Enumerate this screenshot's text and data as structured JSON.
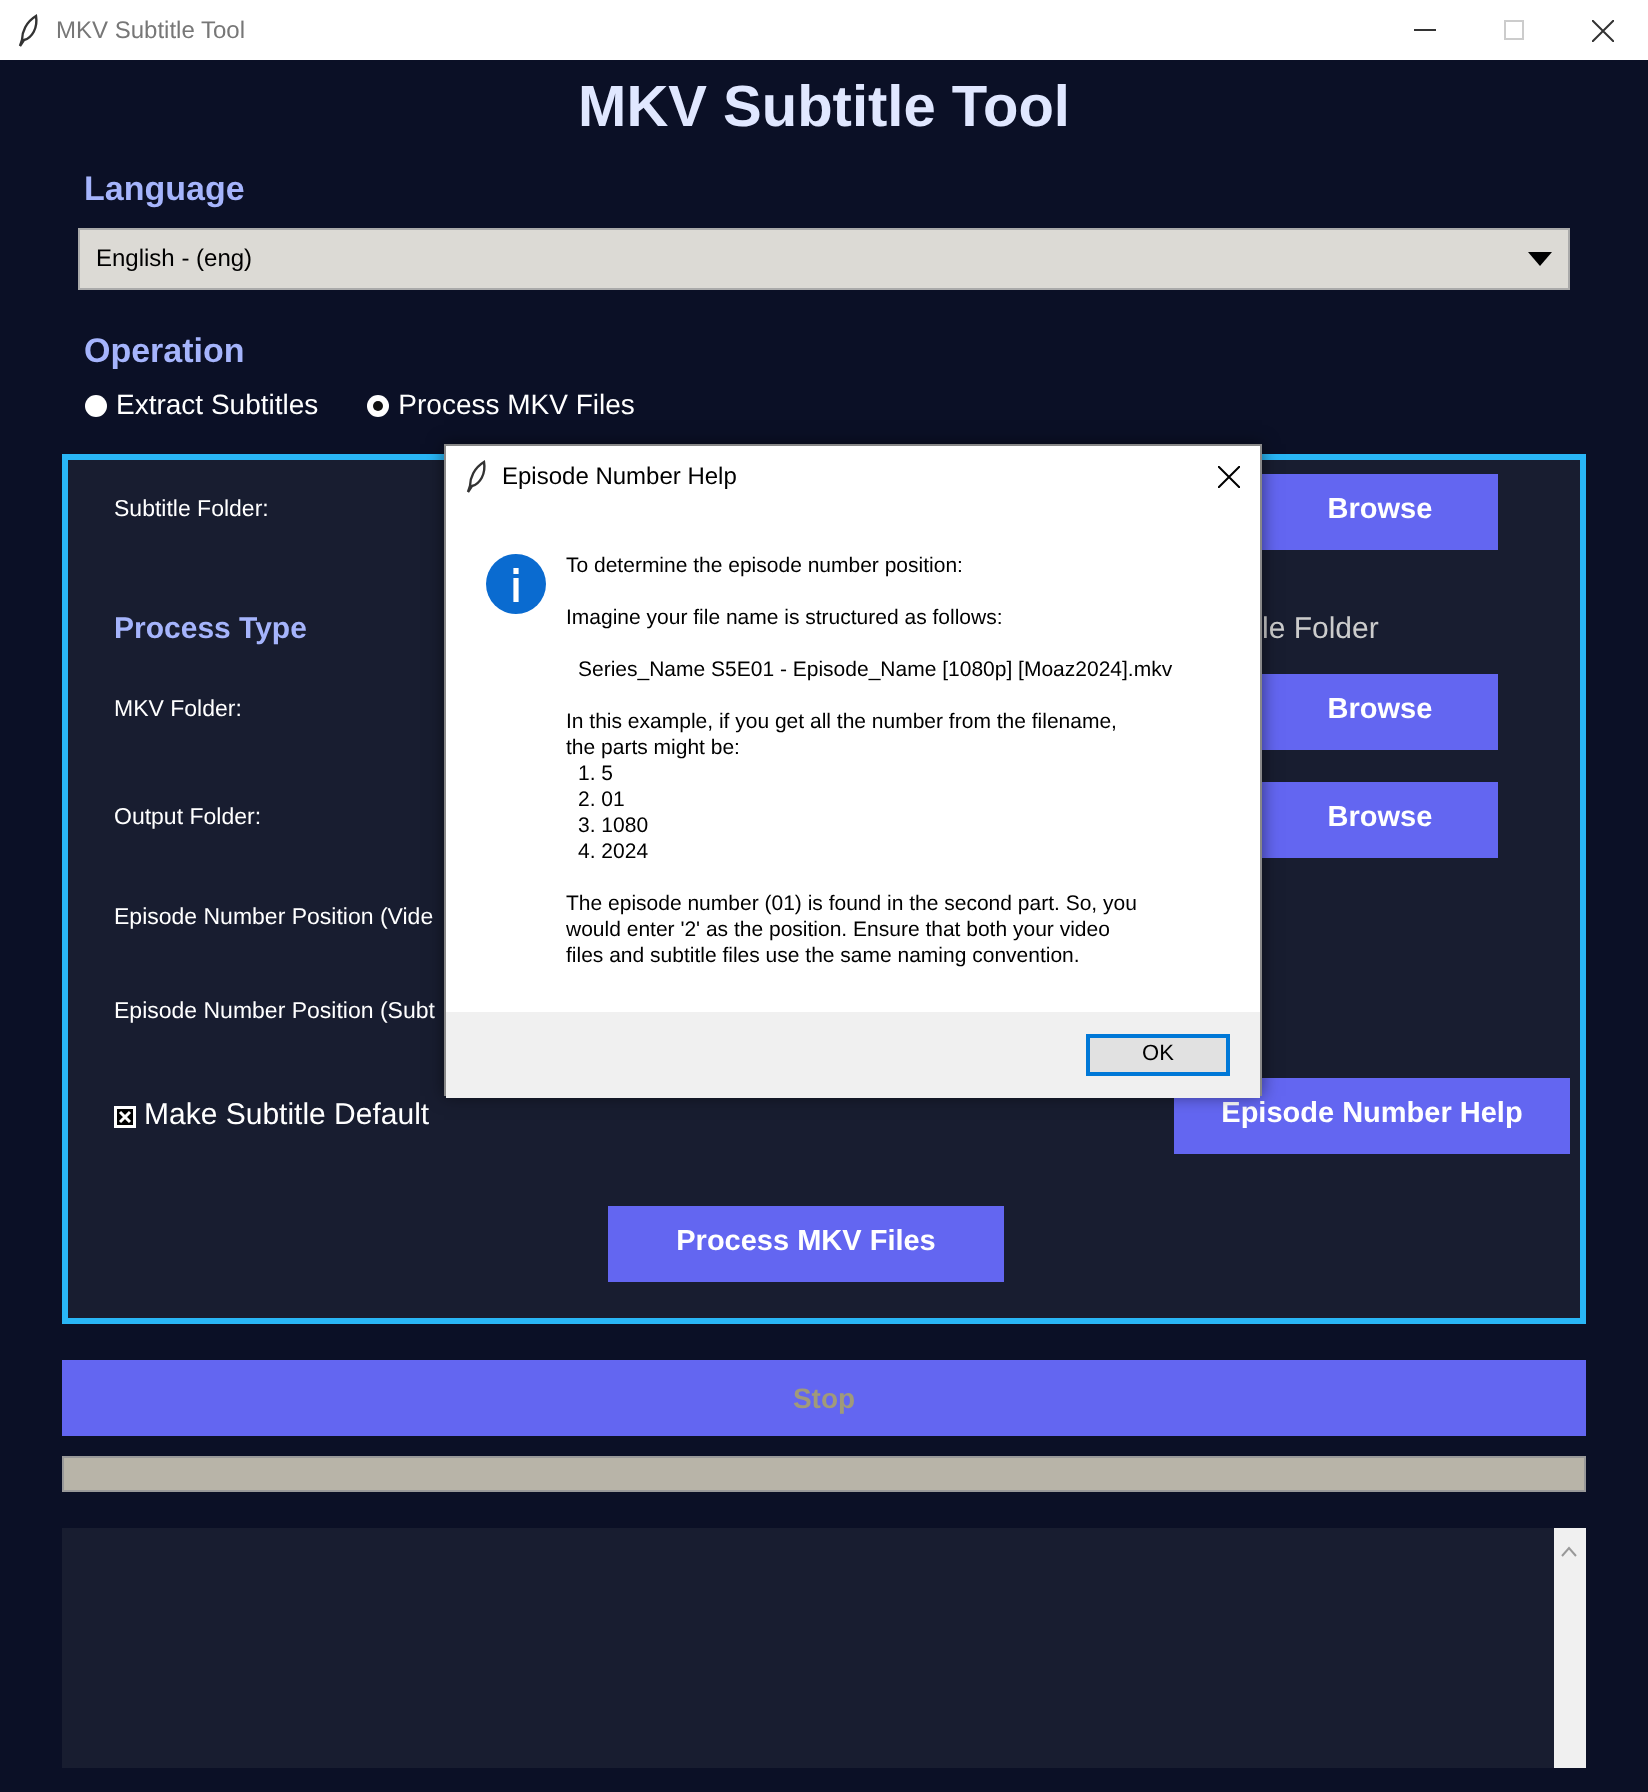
{
  "window": {
    "title": "MKV Subtitle Tool"
  },
  "app_title": "MKV Subtitle Tool",
  "language": {
    "label": "Language",
    "value": "English - (eng)"
  },
  "operation": {
    "label": "Operation",
    "options": [
      {
        "label": "Extract Subtitles",
        "selected": false
      },
      {
        "label": "Process MKV Files",
        "selected": true
      }
    ]
  },
  "panel": {
    "rows": [
      {
        "kind": "folder",
        "label": "Subtitle Folder:",
        "button": "Browse"
      },
      {
        "kind": "heading",
        "label": "Process Type",
        "option": "le Folder"
      },
      {
        "kind": "folder",
        "label": "MKV Folder:",
        "button": "Browse"
      },
      {
        "kind": "folder",
        "label": "Output Folder:",
        "button": "Browse"
      },
      {
        "kind": "text",
        "label": "Episode Number Position (Vide"
      },
      {
        "kind": "text",
        "label": "Episode Number Position (Subt"
      }
    ],
    "default_checkbox": {
      "label": "Make Subtitle Default",
      "checked": true
    },
    "help_button": "Episode Number Help",
    "process_button": "Process MKV Files"
  },
  "stop_button": {
    "label": "Stop",
    "disabled": true
  },
  "progress": {
    "level": 0
  },
  "dialog": {
    "title": "Episode Number Help",
    "blocks": [
      {
        "kind": "text",
        "lines": [
          "To determine the episode number position:"
        ]
      },
      {
        "kind": "text",
        "lines": [
          "Imagine your file name is structured as follows:"
        ]
      },
      {
        "kind": "example",
        "lines": [
          "Series_Name S5E01 - Episode_Name [1080p] [Moaz2024].mkv"
        ]
      },
      {
        "kind": "text",
        "lines": [
          "In this example, if you get all the number from the filename,",
          "the parts might be:"
        ]
      },
      {
        "kind": "list",
        "lines": [
          "1. 5",
          "2. 01",
          "3. 1080",
          "4. 2024"
        ]
      },
      {
        "kind": "text",
        "lines": [
          "The episode number (01) is found in the second part. So, you",
          "would enter '2' as the position. Ensure that both your video",
          "files and subtitle files use the same naming convention."
        ]
      }
    ],
    "ok": "OK"
  }
}
